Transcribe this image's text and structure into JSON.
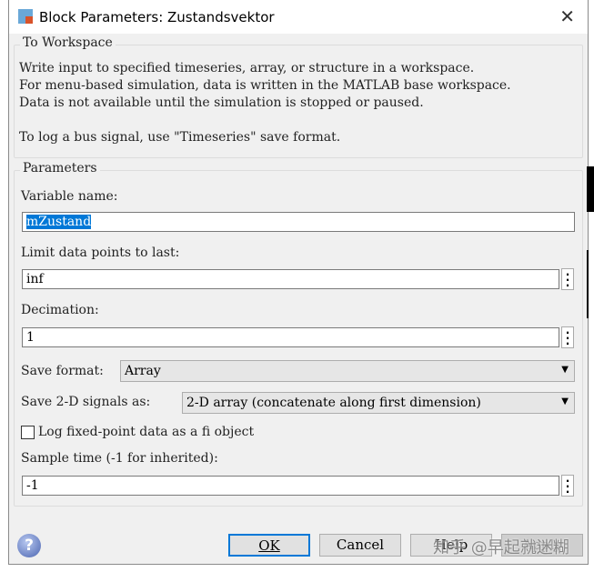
{
  "window": {
    "title": "Block Parameters: Zustandsvektor"
  },
  "description": {
    "legend": "To Workspace",
    "lines": [
      "Write input to specified timeseries, array, or structure in a workspace.",
      "For menu-based simulation, data is written in the MATLAB base workspace.",
      "Data is not available until the simulation is stopped or paused.",
      "To log a bus signal, use \"Timeseries\" save format."
    ]
  },
  "parameters": {
    "legend": "Parameters",
    "variable_name": {
      "label": "Variable name:",
      "value": "mZustand"
    },
    "limit": {
      "label": "Limit data points to last:",
      "value": "inf"
    },
    "decimation": {
      "label": "Decimation:",
      "value": "1"
    },
    "save_format": {
      "label": "Save format:",
      "value": "Array"
    },
    "save_2d": {
      "label": "Save 2-D signals as:",
      "value": "2-D array (concatenate along first dimension)"
    },
    "log_fixed": {
      "label": "Log fixed-point data as a fi object",
      "checked": false
    },
    "sample_time": {
      "label": "Sample time (-1 for inherited):",
      "value": "-1"
    }
  },
  "buttons": {
    "ok": "OK",
    "cancel": "Cancel",
    "help": "Help",
    "apply": "Apply"
  },
  "watermark": "知乎 @早起就迷糊",
  "colors": {
    "selection": "#0078d7",
    "ok_border": "#0078d7"
  }
}
